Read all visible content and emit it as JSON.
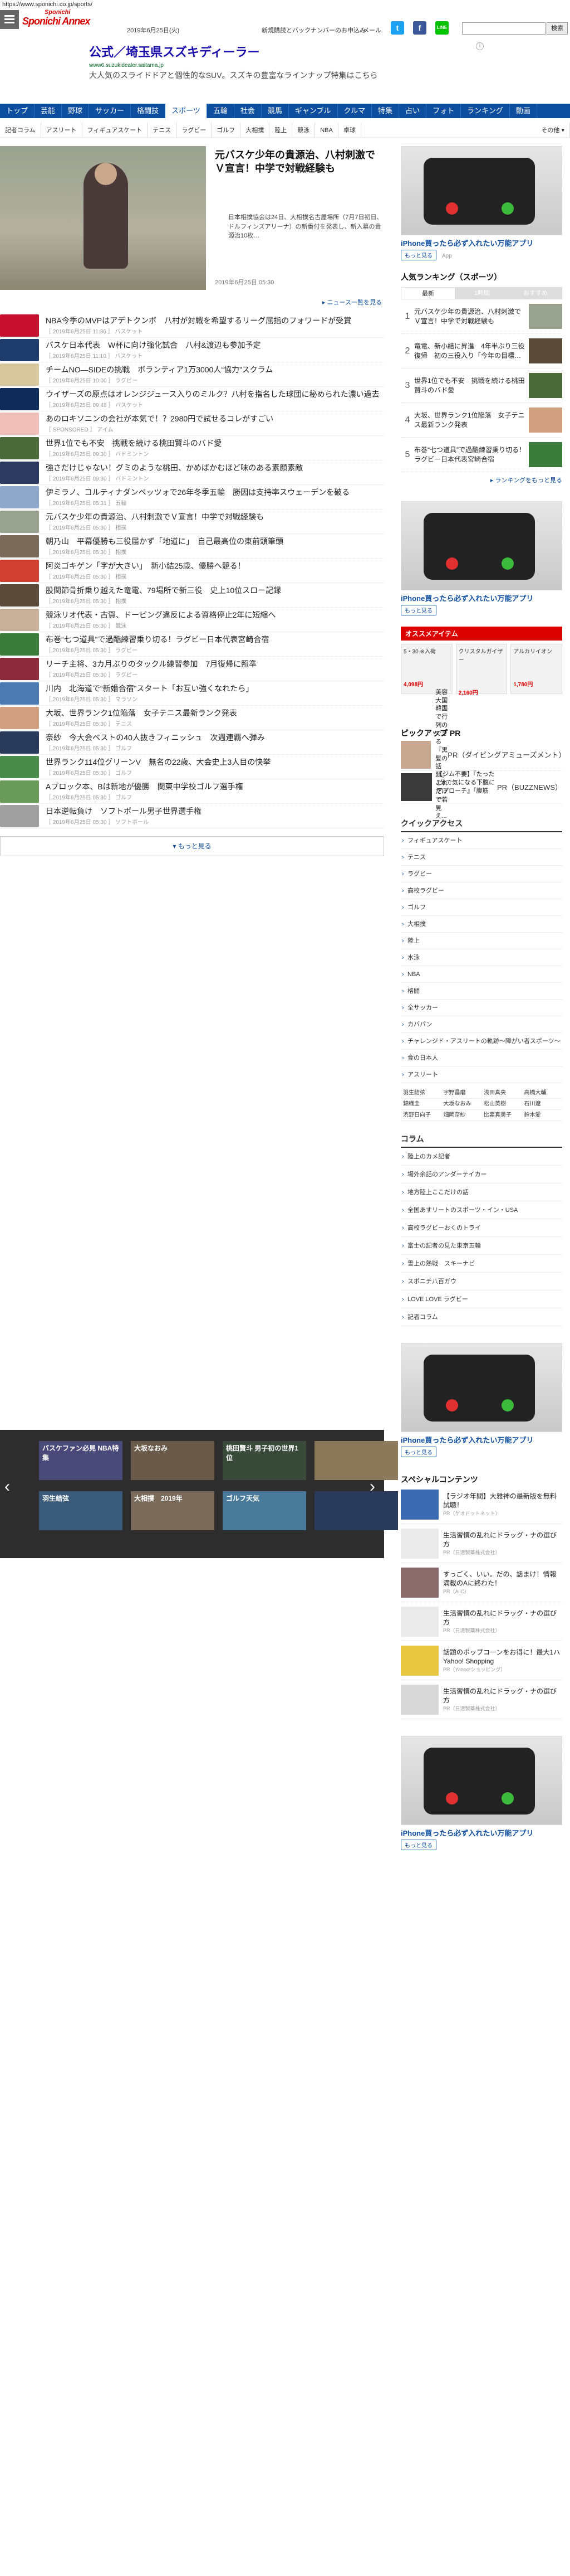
{
  "url": "https://www.sponichi.co.jp/sports/",
  "header": {
    "logo_top": "Sponichi",
    "logo_main": "Sponichi Annex",
    "date": "2019年6月25日(火)",
    "links": [
      "新規購読とバックナンバーのお申込み",
      "メール"
    ],
    "search_button": "検索",
    "search_placeholder": ""
  },
  "ad_banner": {
    "title": "公式／埼玉県スズキディーラー",
    "url": "www6.suzukidealer.saitama.jp",
    "desc": "大人気のスライドドアと個性的なSUV。スズキの豊富なラインナップ特集はこちら"
  },
  "mainnav": [
    "トップ",
    "芸能",
    "野球",
    "サッカー",
    "格闘技",
    "スポーツ",
    "五輪",
    "社会",
    "競馬",
    "ギャンブル",
    "クルマ",
    "特集",
    "占い",
    "フォト",
    "ランキング",
    "動画"
  ],
  "subnav": [
    "記者コラム",
    "アスリート",
    "フィギュアスケート",
    "テニス",
    "ラグビー",
    "ゴルフ",
    "大相撲",
    "陸上",
    "競泳",
    "NBA",
    "卓球"
  ],
  "subnav_more": "その他 ▾",
  "hero": {
    "title": "元バスケ少年の貴源治、八村刺激でＶ宣言！中学で対戦経験も",
    "desc": "日本相撲協会は24日、大相撲名古屋場所（7月7日初日、ドルフィンズアリーナ）の新番付を発表し、新入幕の貴源治10枚…",
    "date": "2019年6月25日 05:30"
  },
  "news_list_link": "ニュース一覧を見る",
  "news": [
    {
      "title": "NBA今季のMVPはアデトクンボ　八村が対戦を希望するリーグ屈指のフォワードが受賞",
      "meta": "［ 2019年6月25日 11:36 ］ バスケット",
      "c": "#c8102e"
    },
    {
      "title": "バスケ日本代表　W杯に向け強化試合　八村&渡辺も参加予定",
      "meta": "［ 2019年6月25日 11:10 ］ バスケット",
      "c": "#1d3b6b"
    },
    {
      "title": "チームNO―SIDEの挑戦　ボランティア1万3000人“協力”スクラム",
      "meta": "［ 2019年6月25日 10:00 ］ ラグビー",
      "c": "#d8c8a0"
    },
    {
      "title": "ウイザーズの原点はオレンジジュース入りのミルク？八村を指名した球団に秘められた濃い過去",
      "meta": "［ 2019年6月25日 09:48 ］ バスケット",
      "c": "#0e2a59"
    },
    {
      "title": "あのロキソニンの会社が本気で！？2980円で試せるコレがすごい",
      "meta": "［ SPONSORED ］ アイム",
      "c": "#f0c0b8"
    },
    {
      "title": "世界1位でも不安　挑戦を続ける桃田賢斗のバド愛",
      "meta": "［ 2019年6月25日 09:30 ］ バドミントン",
      "c": "#4a6a3a"
    },
    {
      "title": "強さだけじゃない！グミのような桃田、かめばかむほど味のある素顔素敵",
      "meta": "［ 2019年6月25日 09:30 ］ バドミントン",
      "c": "#2b3a5e"
    },
    {
      "title": "伊ミラノ、コルティナダンペッツォで26年冬季五輪　勝因は支持率スウェーデンを破る",
      "meta": "［ 2019年6月25日 05:31 ］ 五輪",
      "c": "#8fa7c8"
    },
    {
      "title": "元バスケ少年の貴源治、八村刺激でＶ宣言！中学で対戦経験も",
      "meta": "［ 2019年6月25日 05:30 ］ 相撲",
      "c": "#9aa38f"
    },
    {
      "title": "朝乃山　平幕優勝も三役届かず「地道に」　自己最高位の東前頭筆頭",
      "meta": "［ 2019年6月25日 05:30 ］ 相撲",
      "c": "#7a6a5a"
    },
    {
      "title": "阿炎ゴキゲン「字が大きい」　新小結25歳、優勝へ競る！",
      "meta": "［ 2019年6月25日 05:30 ］ 相撲",
      "c": "#d04030"
    },
    {
      "title": "股関節骨折乗り越えた竜電、79場所で新三役　史上10位スロー記録",
      "meta": "［ 2019年6月25日 05:30 ］ 相撲",
      "c": "#5a4a3a"
    },
    {
      "title": "競泳リオ代表・古賀、ドーピング違反による資格停止2年に短縮へ",
      "meta": "［ 2019年6月25日 05:30 ］ 競泳",
      "c": "#c8b098"
    },
    {
      "title": "布巻“七つ道具”で過酷練習乗り切る！ラグビー日本代表宮崎合宿",
      "meta": "［ 2019年6月25日 05:30 ］ ラグビー",
      "c": "#3a7a3a"
    },
    {
      "title": "リーチ主将、3カ月ぶりのタックル練習参加　7月復帰に照準",
      "meta": "［ 2019年6月25日 05:30 ］ ラグビー",
      "c": "#8a2a3a"
    },
    {
      "title": "川内　北海道で“新婚合宿”スタート「お互い強くなれたら」",
      "meta": "［ 2019年6月25日 05:30 ］ マラソン",
      "c": "#4a7ab0"
    },
    {
      "title": "大坂、世界ランク1位陥落　女子テニス最新ランク発表",
      "meta": "［ 2019年6月25日 05:30 ］ テニス",
      "c": "#d0a080"
    },
    {
      "title": "奈紗　今大会ベストの40人抜きフィニッシュ　次週連覇へ弾み",
      "meta": "［ 2019年6月25日 05:30 ］ ゴルフ",
      "c": "#2a3a5a"
    },
    {
      "title": "世界ランク114位グリーンV　無名の22歳、大会史上3人目の快挙",
      "meta": "［ 2019年6月25日 05:30 ］ ゴルフ",
      "c": "#4a8a4a"
    },
    {
      "title": "Aブロック本、Bは新地が優勝　関東中学校ゴルフ選手権",
      "meta": "［ 2019年6月25日 05:30 ］ ゴルフ",
      "c": "#6a9a5a"
    },
    {
      "title": "日本逆転負け　ソフトボール男子世界選手権",
      "meta": "［ 2019年6月25日 05:30 ］ ソフトボール",
      "c": "#a0a0a0"
    }
  ],
  "more_button": "▾ もっと見る",
  "slider": [
    {
      "label": "バスケファン必見 NBA特集",
      "c": "#4a4a7a"
    },
    {
      "label": "大坂なおみ",
      "c": "#6a5a4a"
    },
    {
      "label": "桃田賢斗 男子初の世界1位",
      "c": "#3a4a3a"
    },
    {
      "label": "",
      "c": "#8a7a5a"
    },
    {
      "label": "羽生結弦",
      "c": "#3a5a7a"
    },
    {
      "label": "大相撲　2019年",
      "c": "#7a6a5a"
    },
    {
      "label": "ゴルフ天気",
      "c": "#4a7a9a"
    },
    {
      "label": "",
      "c": "#2a3a5a"
    }
  ],
  "side_ad": {
    "caption": "iPhone買ったら必ず入れたい万能アプリ",
    "cta": "もっと見る",
    "app": "App"
  },
  "ranking": {
    "title": "人気ランキング（スポーツ）",
    "tabs": [
      "最新",
      "1時間",
      "おすすめ"
    ],
    "items": [
      {
        "num": "1",
        "title": "元バスケ少年の貴源治、八村刺激でＶ宣言！中学で対戦経験も",
        "c": "#9aa38f"
      },
      {
        "num": "2",
        "title": "竜電、新小結に昇進　4年半ぶり三役復帰　初の三役入り「今年の目標…",
        "c": "#5a4a3a"
      },
      {
        "num": "3",
        "title": "世界1位でも不安　挑戦を続ける桃田賢斗のバド愛",
        "c": "#4a6a3a"
      },
      {
        "num": "4",
        "title": "大坂、世界ランク1位陥落　女子テニス最新ランク発表",
        "c": "#d0a080"
      },
      {
        "num": "5",
        "title": "布巻“七つ道具”で過酷練習乗り切る！ラグビー日本代表宮崎合宿",
        "c": "#3a7a3a"
      }
    ],
    "more": "ランキングをもっと見る"
  },
  "osusume": {
    "title": "オススメアイテム",
    "items": [
      {
        "name": "5・30 ※入荷",
        "price": "4,098円"
      },
      {
        "name": "クリスタルガイザー",
        "price": "2,160円"
      },
      {
        "name": "アルカリイオン",
        "price": "1,780円"
      }
    ]
  },
  "pickup": {
    "title": "ピックアップ PR",
    "items": [
      {
        "title": "美容大国韓国で行列のできる『黒髪の話題』これだけで若見え...",
        "src": "PR（ダイビングアミューズメント）",
        "c": "#c8a890"
      },
      {
        "title": "【ジム不要】『たった1分で気になる下腹にアプローチ』「腹筋一...",
        "src": "PR（BUZZNEWS）",
        "c": "#3a3a3a"
      }
    ]
  },
  "quick": {
    "title": "クイックアクセス",
    "items": [
      "フィギュアスケート",
      "テニス",
      "ラグビー",
      "高校ラグビー",
      "ゴルフ",
      "大相撲",
      "陸上",
      "水泳",
      "NBA",
      "格闘",
      "全サッカー",
      "カバパン",
      "チャレンジド・アスリートの軌跡～障がい者スポーツ～",
      "食の日本人",
      "アスリート"
    ],
    "names": [
      "羽生結弦",
      "宇野昌磨",
      "浅田真央",
      "高橋大輔",
      "錦織圭",
      "大坂なおみ",
      "松山英樹",
      "石川遼",
      "渋野日向子",
      "畑岡奈紗",
      "比嘉真美子",
      "鈴木愛"
    ]
  },
  "column": {
    "title": "コラム",
    "items": [
      "陸上のカメ記者",
      "場外余話のアンダーテイカー",
      "地方陸上ここだけの話",
      "全国あすリートのスポーツ・イン・USA",
      "高校ラグビーおくのトライ",
      "富士の記者の見た東京五輪",
      "雪上の熱戦　スキーナビ",
      "スポニチ八百ガウ",
      "LOVE LOVE ラグビー",
      "記者コラム"
    ]
  },
  "special": {
    "title": "スペシャルコンテンツ",
    "items": [
      {
        "title": "【ラジオ年間】大雅神の最新版を無料試聴！",
        "src": "PR（ゲオドットネット）",
        "c": "#3a6ab0"
      },
      {
        "title": "生活習慣の乱れにドラッグ・ナの選び方",
        "src": "PR（日清製薬株式会社）",
        "c": "#eaeaea"
      },
      {
        "title": "すっごく、いい。だの、話まけ！情報満載のAに終わた！",
        "src": "PR（AiiC）",
        "c": "#8a6a6a"
      },
      {
        "title": "生活習慣の乱れにドラッグ・ナの選び方",
        "src": "PR（日清製薬株式会社）",
        "c": "#eaeaea"
      },
      {
        "title": "話題のポップコーンをお得に！最大1ハYahoo! Shopping",
        "src": "PR（Yahoo!ショッピング）",
        "c": "#e8c840"
      },
      {
        "title": "生活習慣の乱れにドラッグ・ナの選び方",
        "src": "PR（日清製薬株式会社）",
        "c": "#d8d8d8"
      }
    ]
  }
}
